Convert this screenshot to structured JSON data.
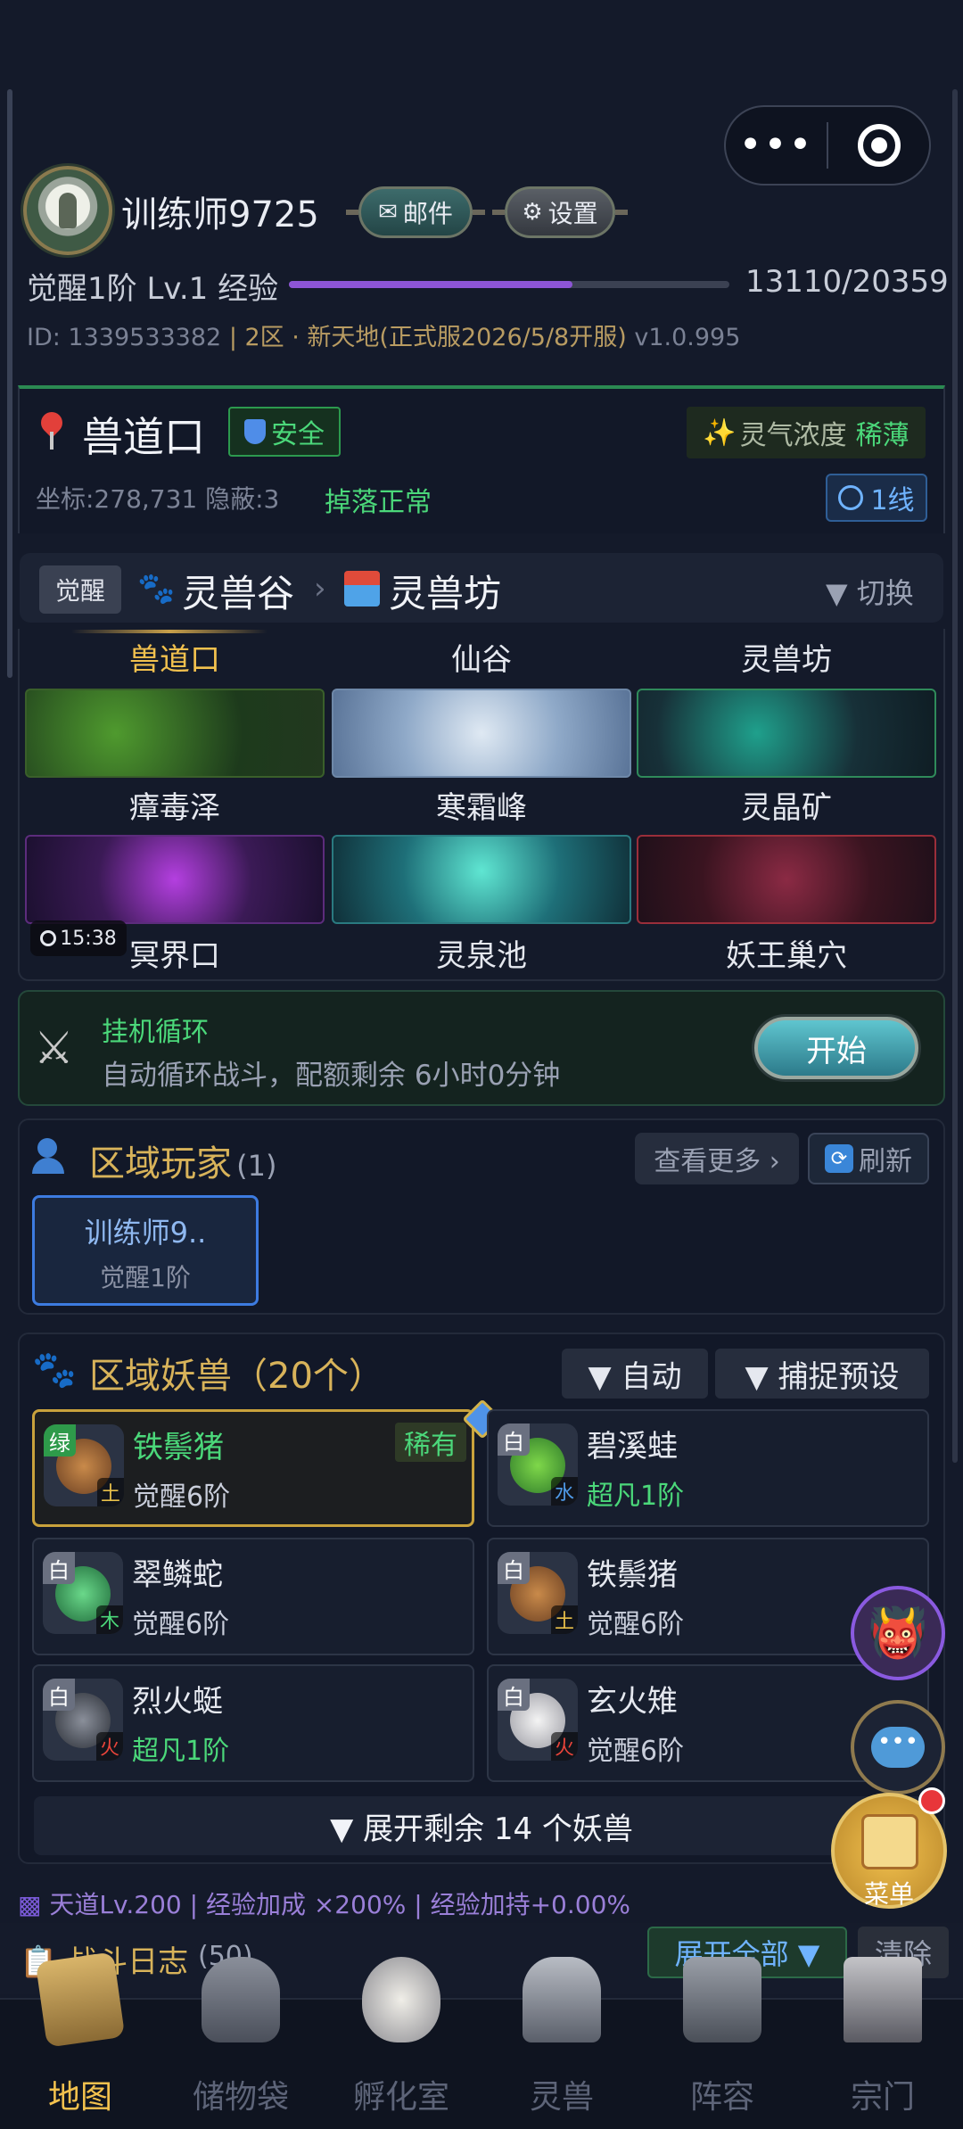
{
  "capsule": {
    "more": "•••"
  },
  "header": {
    "player_name": "训练师9725",
    "mail_label": "邮件",
    "settings_label": "设置",
    "level_text": "觉醒1阶 Lv.1 经验",
    "exp_current": 13110,
    "exp_max": 20359,
    "exp_text": "13110/20359",
    "id_text": "ID: 1339533382",
    "server_text": "| 2区 · 新天地(正式服2026/5/8开服)",
    "version": "v1.0.995"
  },
  "location": {
    "name": "兽道口",
    "safe_label": "安全",
    "aura_label": "灵气浓度",
    "aura_value": "稀薄",
    "coord_text": "坐标:278,731   隐蔽:3",
    "drop_status": "掉落正常",
    "line_label": "1线"
  },
  "breadcrumb": {
    "tag": "觉醒",
    "level1": "灵兽谷",
    "sep": "›",
    "level2": "灵兽坊",
    "switch_label": "▼ 切换"
  },
  "maps": [
    {
      "name": "兽道口",
      "active": true
    },
    {
      "name": "仙谷",
      "active": false
    },
    {
      "name": "灵兽坊",
      "active": false
    },
    {
      "name": "瘴毒泽",
      "active": false
    },
    {
      "name": "寒霜峰",
      "active": false
    },
    {
      "name": "灵晶矿",
      "active": false
    },
    {
      "name": "冥界口",
      "active": false,
      "timer": "15:38"
    },
    {
      "name": "灵泉池",
      "active": false
    },
    {
      "name": "妖王巢穴",
      "active": false
    }
  ],
  "auto_loop": {
    "title": "挂机循环",
    "desc": "自动循环战斗，配额剩余 6小时0分钟",
    "start_label": "开始"
  },
  "region_players": {
    "title": "区域玩家",
    "count": "(1)",
    "more_label": "查看更多 ›",
    "refresh_label": "刷新",
    "players": [
      {
        "name": "训练师9..",
        "level": "觉醒1阶"
      }
    ]
  },
  "region_beasts": {
    "title": "区域妖兽（20个）",
    "auto_label": "▼ 自动",
    "preset_label": "▼ 捕捉预设",
    "beasts": [
      {
        "rarity": "绿",
        "element": "土",
        "name": "铁鬃猪",
        "level": "觉醒6阶",
        "tag": "稀有"
      },
      {
        "rarity": "白",
        "element": "水",
        "name": "碧溪蛙",
        "level": "超凡1阶"
      },
      {
        "rarity": "白",
        "element": "木",
        "name": "翠鳞蛇",
        "level": "觉醒6阶"
      },
      {
        "rarity": "白",
        "element": "土",
        "name": "铁鬃猪",
        "level": "觉醒6阶"
      },
      {
        "rarity": "白",
        "element": "火",
        "name": "烈火蜓",
        "level": "超凡1阶"
      },
      {
        "rarity": "白",
        "element": "火",
        "name": "玄火雉",
        "level": "觉醒6阶"
      }
    ],
    "expand_label": "▼ 展开剩余 14 个妖兽"
  },
  "floating": {
    "menu_label": "菜单",
    "chat_icon": "•••"
  },
  "status": {
    "tiandao": "天道Lv.200 | 经验加成 ×200% | 经验加持+0.00%",
    "log_title": "战斗日志",
    "log_count": "(50)",
    "expand_all": "展开全部 ▼",
    "clear": "清除"
  },
  "nav": [
    {
      "label": "地图",
      "active": true
    },
    {
      "label": "储物袋",
      "active": false
    },
    {
      "label": "孵化室",
      "active": false
    },
    {
      "label": "灵兽",
      "active": false
    },
    {
      "label": "阵容",
      "active": false
    },
    {
      "label": "宗门",
      "active": false
    }
  ],
  "colors": {
    "accent_gold": "#f2c14e",
    "safe_green": "#4bd87a",
    "exp_purple": "#8d55d6",
    "bg": "#141a2a"
  }
}
